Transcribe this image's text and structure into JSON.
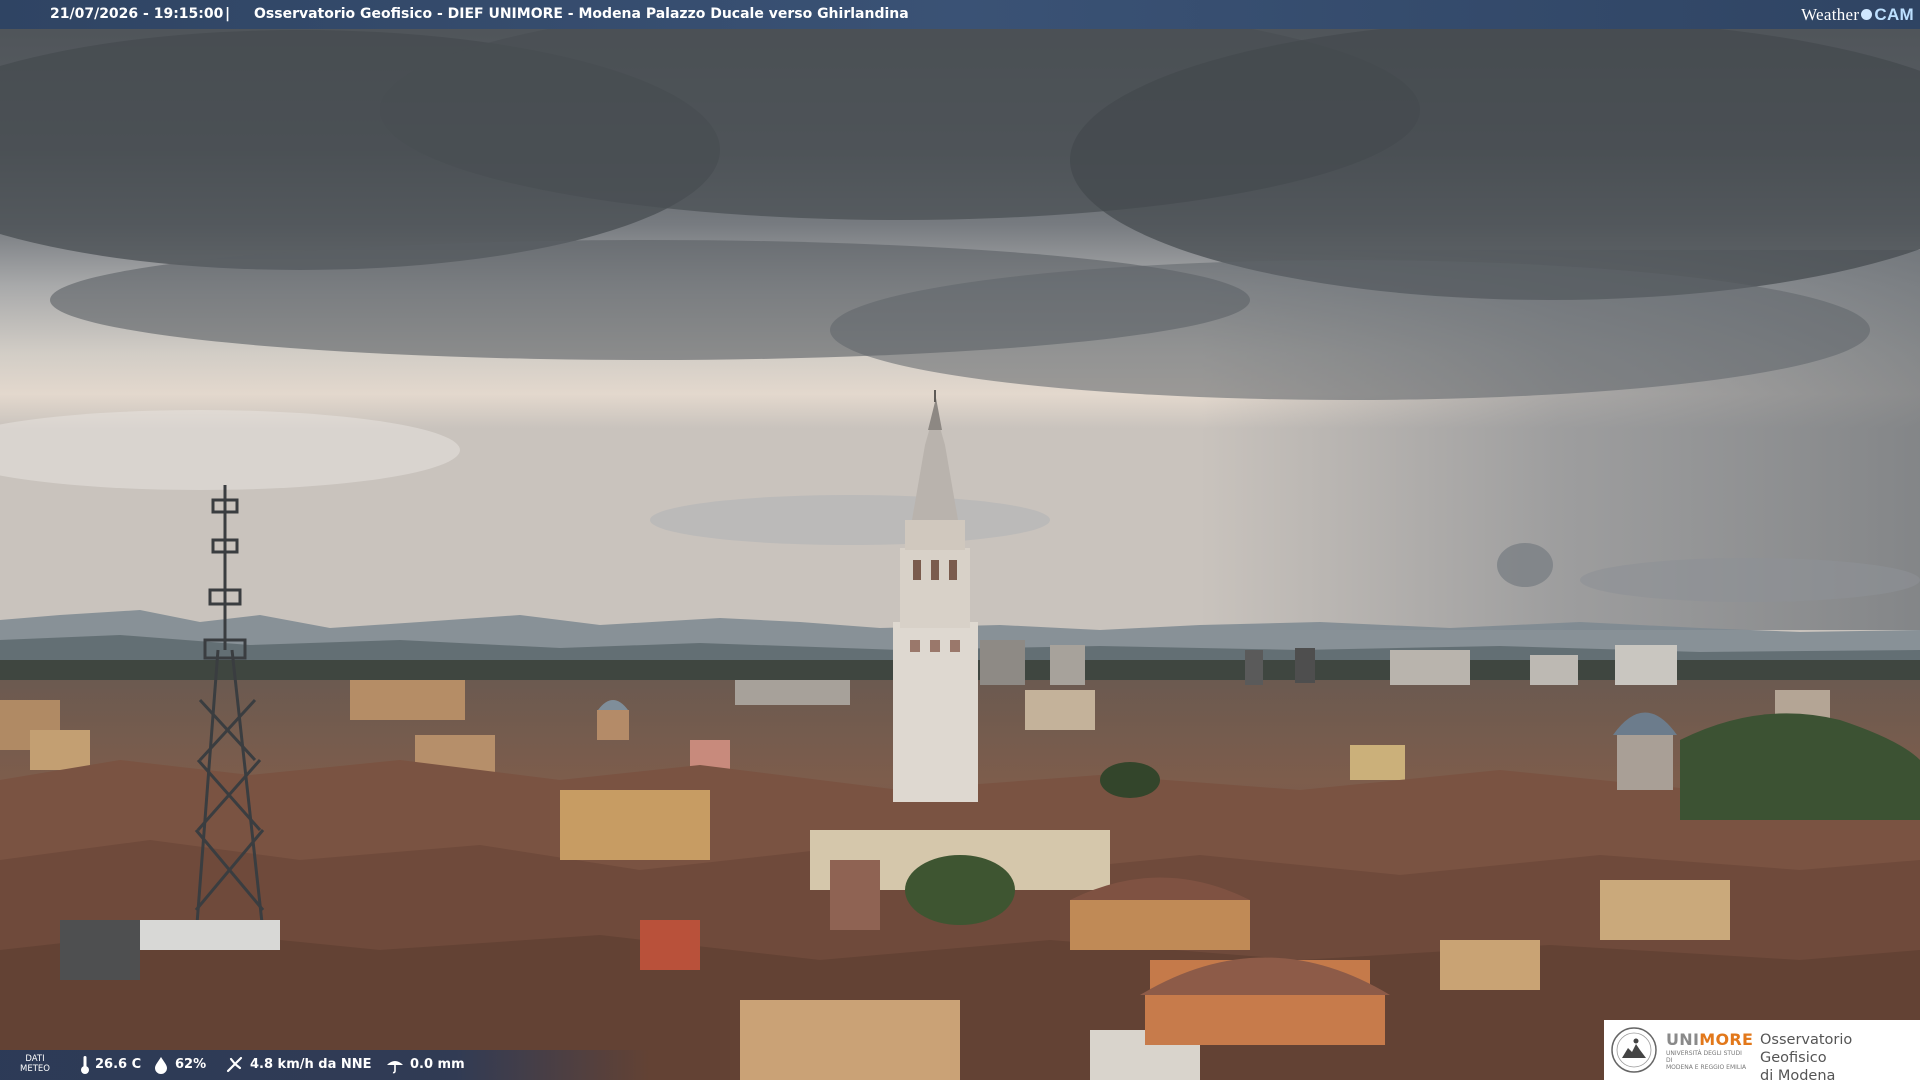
{
  "header": {
    "datetime": "21/07/2026 - 19:15:00",
    "separator": "|",
    "title": "Osservatorio Geofisico - DIEF UNIMORE - Modena Palazzo Ducale verso Ghirlandina"
  },
  "brand": {
    "word1": "Weather",
    "word2": "CAM"
  },
  "meteo": {
    "label_line1": "DATI",
    "label_line2": "METEO",
    "temperature": "26.6 C",
    "humidity": "62%",
    "wind": "4.8 km/h da NNE",
    "rain": "0.0 mm",
    "icons": [
      "thermometer-icon",
      "droplet-icon",
      "wind-icon",
      "rain-icon"
    ]
  },
  "logo": {
    "name_part1": "UNI",
    "name_part2": "MORE",
    "subtitle_line1": "UNIVERSITÀ DEGLI STUDI DI",
    "subtitle_line2": "MODENA E REGGIO EMILIA",
    "observatory_line1": "Osservatorio Geofisico",
    "observatory_line2": "di Modena"
  },
  "colors": {
    "bar": "#2f4463",
    "accent": "#e2781b",
    "sky_dark": "#4a4f55",
    "sky_light": "#d9d2c8",
    "roof": "#8a5a45"
  }
}
